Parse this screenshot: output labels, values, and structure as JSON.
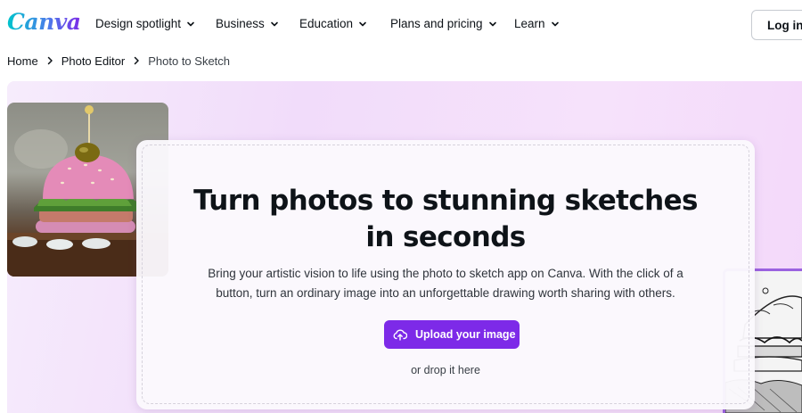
{
  "brand": {
    "logo_text": "Canva"
  },
  "nav": {
    "items": [
      {
        "label": "Design spotlight"
      },
      {
        "label": "Business"
      },
      {
        "label": "Education"
      },
      {
        "label": "Plans and pricing"
      },
      {
        "label": "Learn"
      }
    ],
    "login_label": "Log in"
  },
  "breadcrumb": {
    "items": [
      "Home",
      "Photo Editor",
      "Photo to Sketch"
    ]
  },
  "hero": {
    "title_line1": "Turn photos to stunning sketches",
    "title_line2": "in seconds",
    "description_line1": "Bring your artistic vision to life using the photo to sketch app on Canva. With the click of a",
    "description_line2": "button, turn an ordinary image into an unforgettable drawing worth sharing with others.",
    "upload_label": "Upload your image",
    "drop_text": "or drop it here"
  },
  "colors": {
    "accent": "#7d2ae8",
    "logo_start": "#00c4cc",
    "logo_end": "#7d2ae8",
    "hero_background": "#f3dcfa"
  },
  "icons": {
    "nav_chevron": "chevron-down-icon",
    "breadcrumb_separator": "chevron-right-icon",
    "upload": "cloud-upload-icon"
  }
}
